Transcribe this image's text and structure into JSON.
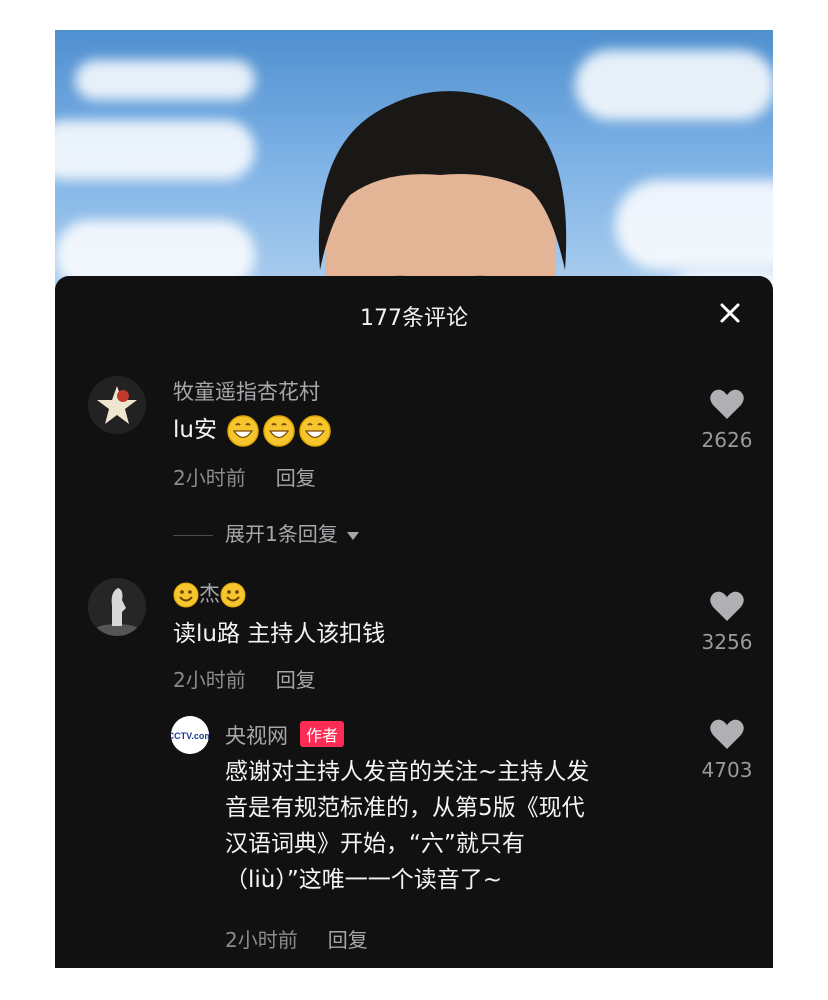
{
  "panel": {
    "title": "177条评论"
  },
  "comments": [
    {
      "username": "牧童遥指杏花村",
      "text": "lu安",
      "emoji_count": 3,
      "emoji_icon": "grinning-emoji-icon",
      "time": "2小时前",
      "reply_label": "回复",
      "likes": "2626",
      "expand_label": "展开1条回复"
    },
    {
      "username": "杰",
      "text": "读lu路 主持人该扣钱",
      "time": "2小时前",
      "reply_label": "回复",
      "likes": "3256",
      "reply": {
        "username": "央视网",
        "badge": "作者",
        "text_lines": [
          "感谢对主持人发音的关注~主持人发",
          "音是有规范标准的，从第5版《现代",
          "汉语词典》开始，“六”就只有",
          "（liù）”这唯一一个读音了~"
        ],
        "time": "2小时前",
        "reply_label": "回复",
        "likes": "4703",
        "avatar_label": "CCTV.com"
      }
    }
  ],
  "colors": {
    "panel_bg": "#111112",
    "badge_bg": "#fe2c55",
    "heart": "#b0b0b4"
  }
}
